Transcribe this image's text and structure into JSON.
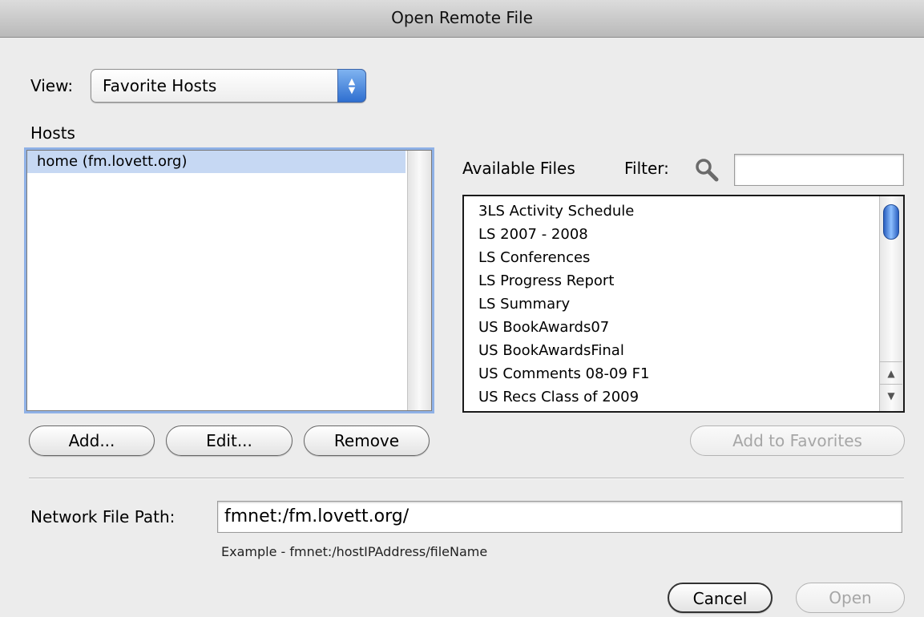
{
  "window": {
    "title": "Open Remote File"
  },
  "view": {
    "label": "View:",
    "selected": "Favorite Hosts"
  },
  "hosts": {
    "label": "Hosts",
    "items": [
      "home (fm.lovett.org)"
    ],
    "buttons": {
      "add": "Add...",
      "edit": "Edit...",
      "remove": "Remove"
    }
  },
  "files": {
    "label": "Available Files",
    "filter_label": "Filter:",
    "filter_value": "",
    "items": [
      "3LS Activity Schedule",
      "LS 2007 - 2008",
      "LS Conferences",
      "LS Progress Report",
      "LS Summary",
      "US BookAwards07",
      "US BookAwardsFinal",
      "US Comments 08-09 F1",
      "US Recs Class of 2009"
    ],
    "add_to_favorites": "Add to Favorites"
  },
  "network": {
    "label": "Network File Path:",
    "value": "fmnet:/fm.lovett.org/",
    "example": "Example - fmnet:/hostIPAddress/fileName"
  },
  "footer": {
    "cancel": "Cancel",
    "open": "Open"
  },
  "icons": {
    "filter": "search-icon",
    "popup": "up-down-arrows-icon"
  },
  "colors": {
    "selection": "#c6d8f3",
    "focus_ring": "#8fb1e6",
    "accent": "#2f6fd0"
  }
}
